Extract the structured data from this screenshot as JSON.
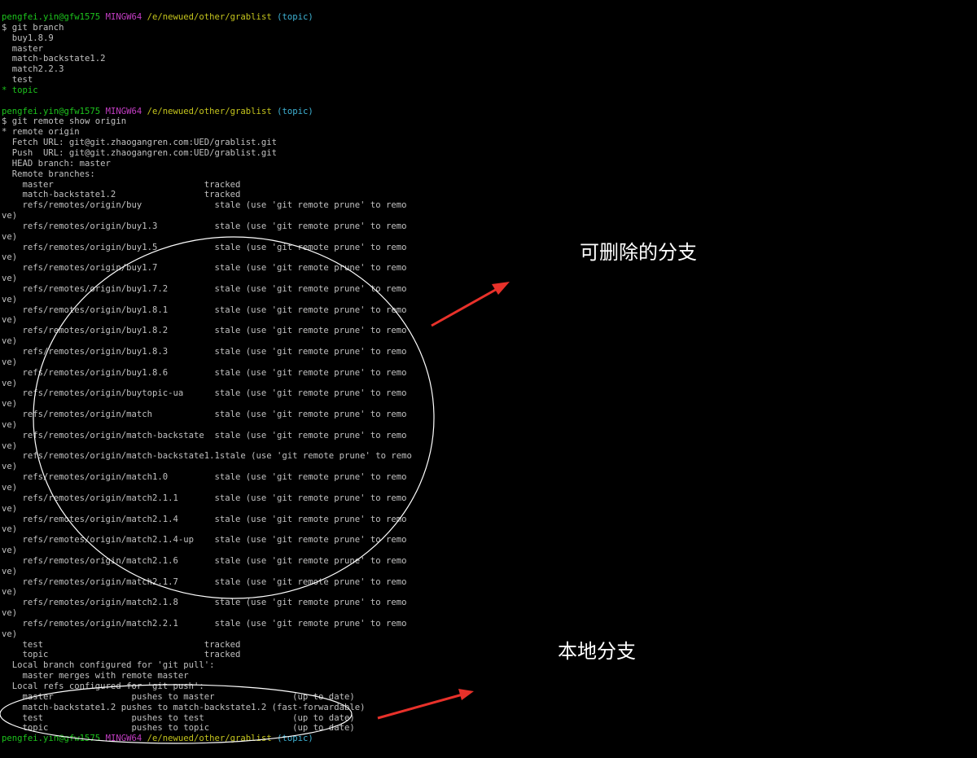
{
  "prompt": {
    "user": "pengfei.yin@gfw1575",
    "system": "MINGW64",
    "path": "/e/newued/other/grablist",
    "branch": "(topic)"
  },
  "commands": {
    "branch": "$ git branch",
    "remote_show": "$ git remote show origin"
  },
  "branch_list": [
    "  buy1.8.9",
    "  master",
    "  match-backstate1.2",
    "  match2.2.3",
    "  test"
  ],
  "current_branch": "* topic",
  "remote_info": [
    "* remote origin",
    "  Fetch URL: git@git.zhaogangren.com:UED/grablist.git",
    "  Push  URL: git@git.zhaogangren.com:UED/grablist.git",
    "  HEAD branch: master",
    "  Remote branches:",
    "    master                             tracked",
    "    match-backstate1.2                 tracked"
  ],
  "stale_refs": [
    "refs/remotes/origin/buy",
    "refs/remotes/origin/buy1.3",
    "refs/remotes/origin/buy1.5",
    "refs/remotes/origin/buy1.7",
    "refs/remotes/origin/buy1.7.2",
    "refs/remotes/origin/buy1.8.1",
    "refs/remotes/origin/buy1.8.2",
    "refs/remotes/origin/buy1.8.3",
    "refs/remotes/origin/buy1.8.6",
    "refs/remotes/origin/buytopic-ua",
    "refs/remotes/origin/match",
    "refs/remotes/origin/match-backstate",
    "refs/remotes/origin/match-backstate1.1",
    "refs/remotes/origin/match1.0",
    "refs/remotes/origin/match2.1.1",
    "refs/remotes/origin/match2.1.4",
    "refs/remotes/origin/match2.1.4-up",
    "refs/remotes/origin/match2.1.6",
    "refs/remotes/origin/match2.1.7",
    "refs/remotes/origin/match2.1.8",
    "refs/remotes/origin/match2.2.1"
  ],
  "stale_suffix": "stale (use 'git remote prune' to remo",
  "stale_wrap": "ve)",
  "tail_lines": [
    "    test                               tracked",
    "    topic                              tracked",
    "  Local branch configured for 'git pull':",
    "    master merges with remote master",
    "  Local refs configured for 'git push':",
    "    master               pushes to master               (up to date)",
    "    match-backstate1.2 pushes to match-backstate1.2 (fast-forwardable)",
    "    test                 pushes to test                 (up to date)",
    "    topic                pushes to topic                (up to date)"
  ],
  "annotations": {
    "removable_branches": "可删除的分支",
    "local_branches": "本地分支"
  }
}
